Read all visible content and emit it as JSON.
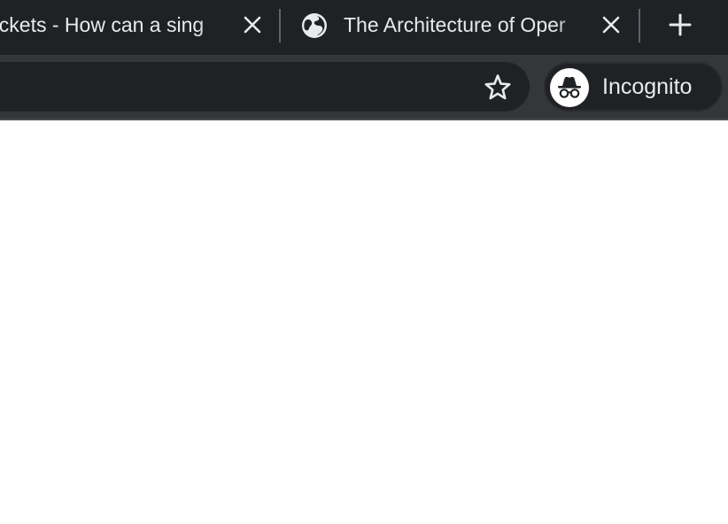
{
  "tabs": [
    {
      "title": "ockets - How can a sing",
      "icon": "",
      "close_icon": "close-icon"
    },
    {
      "title": "The Architecture of Oper",
      "icon": "globe-icon",
      "close_icon": "close-icon"
    }
  ],
  "new_tab_icon": "plus-icon",
  "toolbar": {
    "bookmark_icon": "star-icon",
    "profile": {
      "label": "Incognito",
      "icon": "incognito-icon"
    }
  },
  "colors": {
    "tabstrip_bg": "#202124",
    "toolbar_bg": "#35363a",
    "omnibox_bg": "#202124",
    "text": "#e8eaed",
    "content_bg": "#ffffff"
  }
}
